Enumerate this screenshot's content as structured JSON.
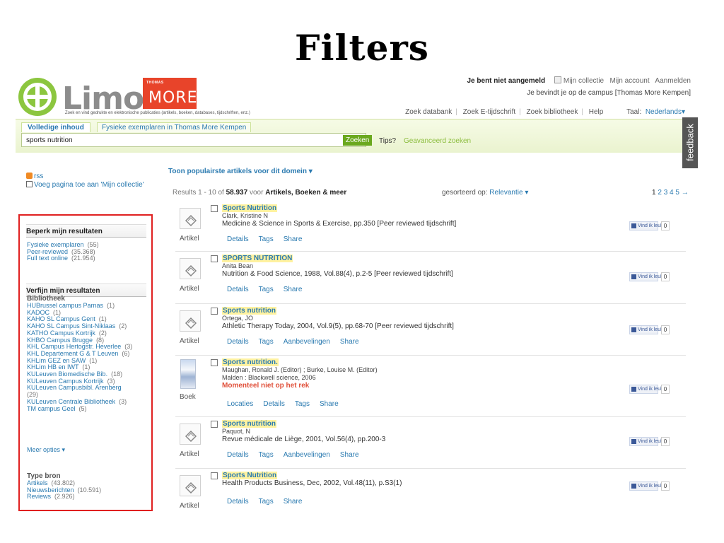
{
  "slide_title": "Filters",
  "header": {
    "logo_text": "Limo",
    "tagline": "Zoek en vind gedrukte en elektronische publicaties (artikels, boeken, databases, tijdschriften, enz.)",
    "partner_small": "THOMAS",
    "partner_big": "MORE",
    "login_status": "Je bent niet aangemeld",
    "my_collection": "Mijn collectie",
    "my_account": "Mijn account",
    "login": "Aanmelden",
    "campus_text": "Je bevindt je op de campus [Thomas More Kempen]",
    "nav": [
      "Zoek databank",
      "Zoek E-tijdschrift",
      "Zoek bibliotheek",
      "Help"
    ],
    "language_label": "Taal:",
    "language_value": "Nederlands"
  },
  "search": {
    "tab_active": "Volledige inhoud",
    "tab_inactive": "Fysieke exemplaren in Thomas More Kempen",
    "query": "sports nutrition",
    "button": "Zoeken",
    "tips": "Tips?",
    "advanced": "Geavanceerd zoeken",
    "feedback": "feedback"
  },
  "sidebar": {
    "rss": "rss",
    "add_page": "Voeg pagina toe aan 'Mijn collectie'",
    "limit_title": "Beperk mijn resultaten",
    "limit_items": [
      {
        "label": "Fysieke exemplaren",
        "count": "(55)"
      },
      {
        "label": "Peer-reviewed",
        "count": "(35.368)"
      },
      {
        "label": "Full text online",
        "count": "(21.954)"
      }
    ],
    "refine_title": "Verfijn mijn resultaten",
    "library_title": "Bibliotheek",
    "libraries": [
      {
        "label": "HUBrussel campus Parnas",
        "count": "(1)"
      },
      {
        "label": "KADOC",
        "count": "(1)"
      },
      {
        "label": "KAHO SL Campus Gent",
        "count": "(1)"
      },
      {
        "label": "KAHO SL Campus Sint-Niklaas",
        "count": "(2)"
      },
      {
        "label": "KATHO Campus Kortrijk",
        "count": "(2)"
      },
      {
        "label": "KHBO Campus Brugge",
        "count": "(8)"
      },
      {
        "label": "KHL Campus Hertogstr. Heverlee",
        "count": "(3)"
      },
      {
        "label": "KHL Departement G & T Leuven",
        "count": "(6)"
      },
      {
        "label": "KHLim GEZ en SAW",
        "count": "(1)"
      },
      {
        "label": "KHLim HB en IWT",
        "count": "(1)"
      },
      {
        "label": "KULeuven Biomedische Bib.",
        "count": "(18)"
      },
      {
        "label": "KULeuven Campus Kortrijk",
        "count": "(3)"
      },
      {
        "label": "KULeuven Campusbibl. Arenberg",
        "count": "(29)"
      },
      {
        "label": "KULeuven Centrale Bibliotheek",
        "count": "(3)"
      },
      {
        "label": "TM campus Geel",
        "count": "(5)"
      }
    ],
    "more_options": "Meer opties",
    "source_title": "Type bron",
    "sources": [
      {
        "label": "Artikels",
        "count": "(43.802)"
      },
      {
        "label": "Nieuwsberichten",
        "count": "(10.591)"
      },
      {
        "label": "Reviews",
        "count": "(2.926)"
      }
    ]
  },
  "results": {
    "popular": "Toon populairste artikels voor dit domein",
    "summary_prefix": "Results 1 - 10 of",
    "summary_total": "58.937",
    "summary_for": "voor",
    "summary_scope": "Artikels, Boeken & meer",
    "sorted_label": "gesorteerd op:",
    "sorted_value": "Relevantie",
    "pages": [
      "1",
      "2",
      "3",
      "4",
      "5"
    ],
    "next": "→",
    "fb_like": "Vind ik leuk",
    "items": [
      {
        "type": "Artikel",
        "title": "Sports Nutrition",
        "author": "Clark, Kristine N",
        "source": "Medicine & Science in Sports & Exercise, pp.350 [Peer reviewed tijdschrift]",
        "actions": [
          "Details",
          "Tags",
          "Share"
        ],
        "likes": "0"
      },
      {
        "type": "Artikel",
        "title": "SPORTS NUTRITION",
        "author": "Anita Bean",
        "source": "Nutrition & Food Science, 1988, Vol.88(4), p.2-5 [Peer reviewed tijdschrift]",
        "actions": [
          "Details",
          "Tags",
          "Share"
        ],
        "likes": "0"
      },
      {
        "type": "Artikel",
        "title": "Sports nutrition",
        "author": "Ortega, JO",
        "source": "Athletic Therapy Today, 2004, Vol.9(5), pp.68-70 [Peer reviewed tijdschrift]",
        "actions": [
          "Details",
          "Tags",
          "Aanbevelingen",
          "Share"
        ],
        "likes": "0"
      },
      {
        "type": "Boek",
        "title": "Sports nutrition.",
        "author": "Maughan, Ronald J. (Editor) ; Burke, Louise M. (Editor)",
        "publisher": "Malden : Blackwell science, 2006",
        "status": "Momenteel niet op het rek",
        "actions": [
          "Locaties",
          "Details",
          "Tags",
          "Share"
        ],
        "likes": "0"
      },
      {
        "type": "Artikel",
        "title": "Sports nutrition",
        "author": "Paquot, N",
        "source": "Revue médicale de Liège, 2001, Vol.56(4), pp.200-3",
        "actions": [
          "Details",
          "Tags",
          "Aanbevelingen",
          "Share"
        ],
        "likes": "0"
      },
      {
        "type": "Artikel",
        "title": "Sports Nutrition",
        "source": "Health Products Business, Dec, 2002, Vol.48(11), p.S3(1)",
        "actions": [
          "Details",
          "Tags",
          "Share"
        ],
        "likes": "0"
      }
    ]
  }
}
